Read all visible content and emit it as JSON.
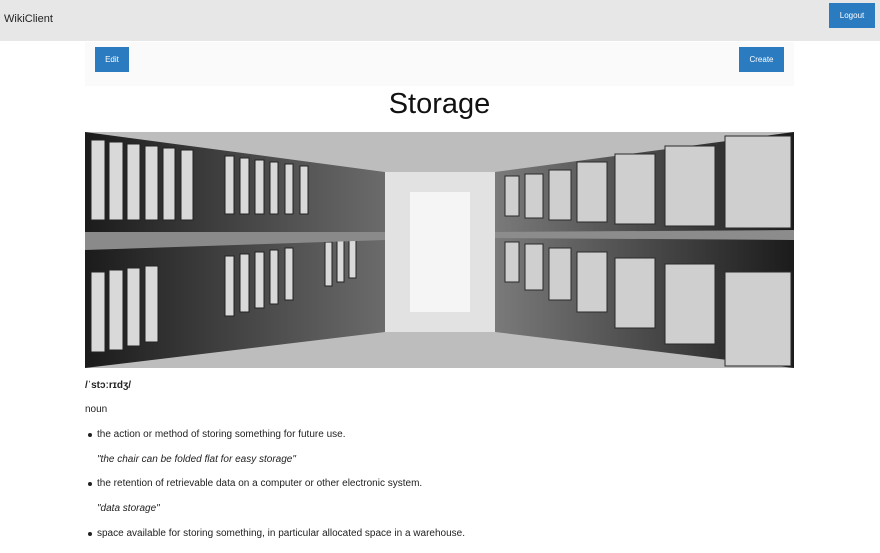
{
  "app": {
    "title": "WikiClient"
  },
  "header": {
    "logout_label": "Logout"
  },
  "toolbar": {
    "edit_label": "Edit",
    "create_label": "Create"
  },
  "page": {
    "title": "Storage",
    "pronunciation": "/ˈstɔːrɪdʒ/",
    "part_of_speech": "noun",
    "definitions": [
      {
        "text": "the action or method of storing something for future use.",
        "example": "\"the chair can be folded flat for easy storage\""
      },
      {
        "text": "the retention of retrievable data on a computer or other electronic system.",
        "example": "\"data storage\""
      },
      {
        "text": "space available for storing something, in particular allocated space in a warehouse."
      }
    ]
  },
  "icons": {
    "hero": "archive-shelves-image"
  }
}
